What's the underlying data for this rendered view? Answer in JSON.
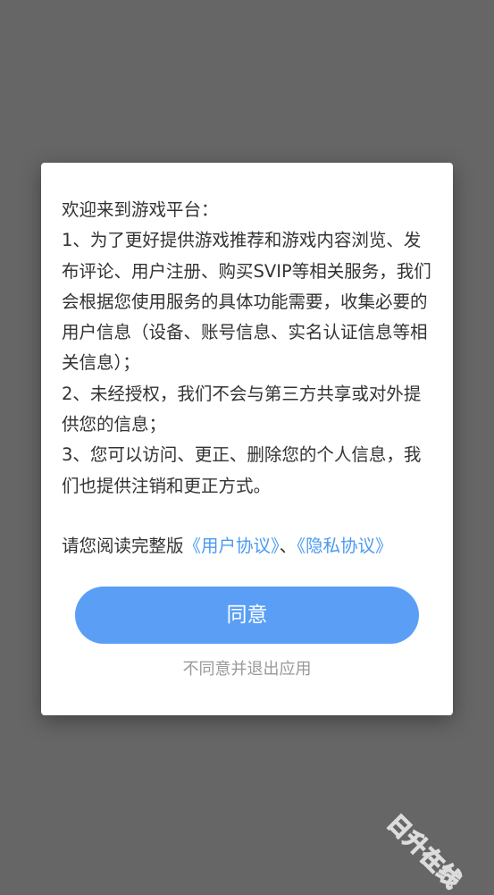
{
  "dialog": {
    "intro": "欢迎来到游戏平台：",
    "items": [
      "1、为了更好提供游戏推荐和游戏内容浏览、发布评论、用户注册、购买SVIP等相关服务，我们会根据您使用服务的具体功能需要，收集必要的用户信息（设备、账号信息、实名认证信息等相关信息）；",
      "2、未经授权，我们不会与第三方共享或对外提供您的信息；",
      "3、您可以访问、更正、删除您的个人信息，我们也提供注销和更正方式。"
    ],
    "read_prompt": "请您阅读完整版",
    "user_agreement": "《用户协议》",
    "separator": "、",
    "privacy_policy": "《隐私协议》",
    "agree_label": "同意",
    "disagree_label": "不同意并退出应用"
  },
  "watermark": "日升在线",
  "colors": {
    "overlay": "#666666",
    "accent": "#5a9ff5",
    "link": "#4a9af0",
    "muted_text": "#999999"
  }
}
